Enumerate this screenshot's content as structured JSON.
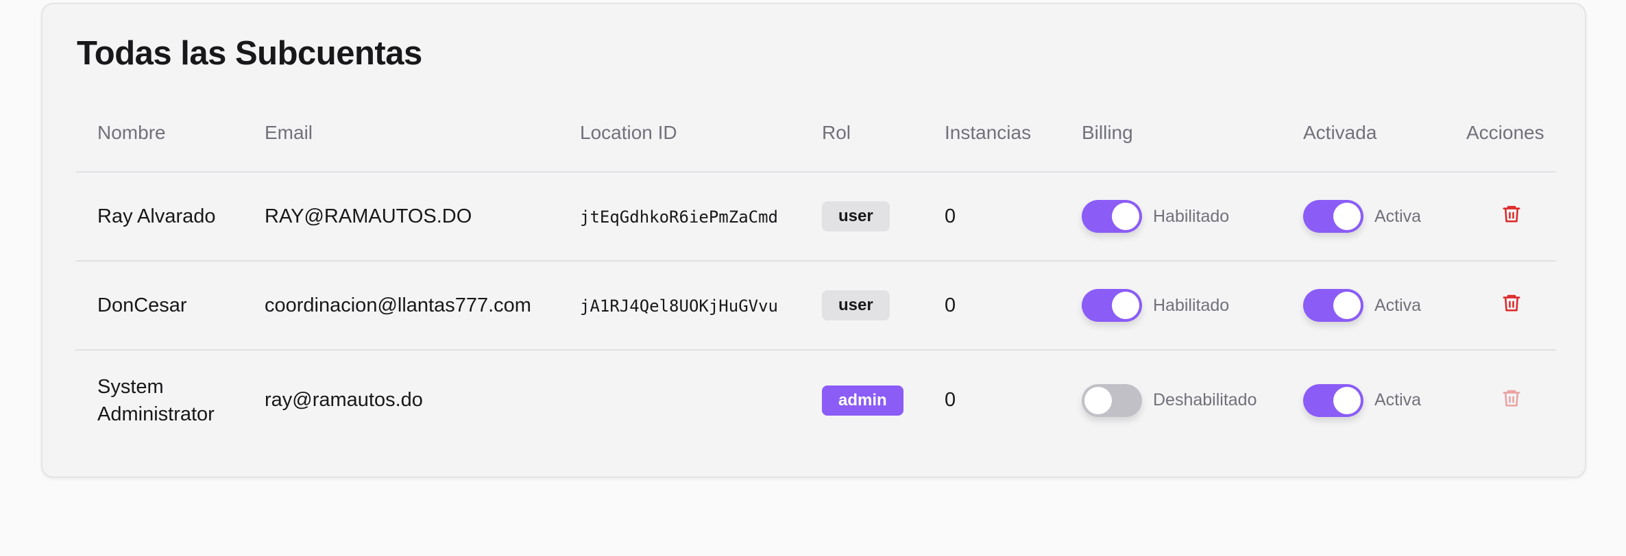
{
  "page": {
    "title": "Todas las Subcuentas"
  },
  "table": {
    "columns": [
      "Nombre",
      "Email",
      "Location ID",
      "Rol",
      "Instancias",
      "Billing",
      "Activada",
      "Acciones"
    ],
    "rows": [
      {
        "name": "Ray Alvarado",
        "email": "RAY@RAMAUTOS.DO",
        "location_id": "jtEqGdhkoR6iePmZaCmd",
        "role": "user",
        "instances": "0",
        "billing": {
          "on": true,
          "label": "Habilitado"
        },
        "activated": {
          "on": true,
          "label": "Activa"
        },
        "delete_enabled": true
      },
      {
        "name": "DonCesar",
        "email": "coordinacion@llantas777.com",
        "location_id": "jA1RJ4Qel8UOKjHuGVvu",
        "role": "user",
        "instances": "0",
        "billing": {
          "on": true,
          "label": "Habilitado"
        },
        "activated": {
          "on": true,
          "label": "Activa"
        },
        "delete_enabled": true
      },
      {
        "name": "System Administrator",
        "email": "ray@ramautos.do",
        "location_id": "",
        "role": "admin",
        "instances": "0",
        "billing": {
          "on": false,
          "label": "Deshabilitado"
        },
        "activated": {
          "on": true,
          "label": "Activa"
        },
        "delete_enabled": false
      }
    ]
  },
  "icons": {
    "delete": "trash-icon"
  },
  "colors": {
    "accent": "#8b5cf6",
    "danger": "#dc2626",
    "toggle_off": "#c0c0c6"
  }
}
